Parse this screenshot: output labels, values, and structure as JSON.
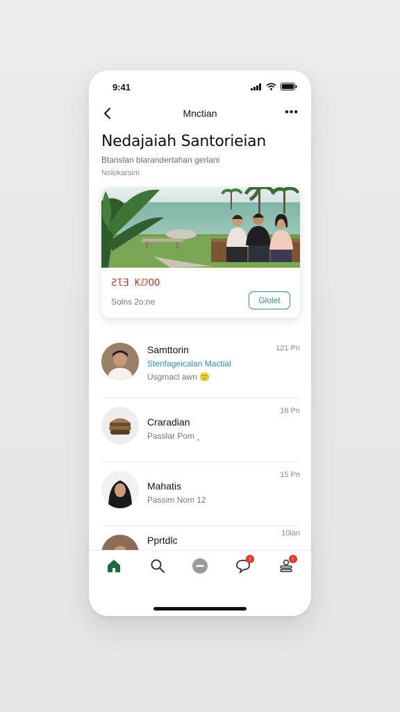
{
  "status_bar": {
    "time": "9:41"
  },
  "nav": {
    "title": "Mnctian",
    "more_label": "•••"
  },
  "header": {
    "title": "Nedajaiah Santorieian",
    "subtitle": "Btanslan blarandertahan gerlani",
    "note": "Nolokarsim"
  },
  "card": {
    "price": "ƧƖƎ ₭ⅅOO",
    "meta": "Solns 2o:ne",
    "button_label": "Glolet"
  },
  "messages": [
    {
      "name": "Samttorin",
      "preview_link": "Stenfageicalan Mactial",
      "preview": "Usgmacl awn 🙂",
      "time": "121 Pn"
    },
    {
      "name": "Craradian",
      "preview": "Passlar Pom ꞈ",
      "time": "16 Pn"
    },
    {
      "name": "Mahatis",
      "preview": "Passim Nom 12",
      "time": "15 Pn"
    },
    {
      "name": "Pprtdlc",
      "preview": "",
      "time": "10ian"
    }
  ],
  "tabs": [
    {
      "icon": "home-icon"
    },
    {
      "icon": "search-icon"
    },
    {
      "icon": "minus-circle-icon"
    },
    {
      "icon": "chat-icon",
      "badge": "!"
    },
    {
      "icon": "profile-icon",
      "badge": "!"
    }
  ],
  "colors": {
    "accent": "#2f8f84",
    "link": "#2f8fb0",
    "price": "#c23b2e",
    "badge": "#e03a2f",
    "home": "#1f6b3a"
  }
}
